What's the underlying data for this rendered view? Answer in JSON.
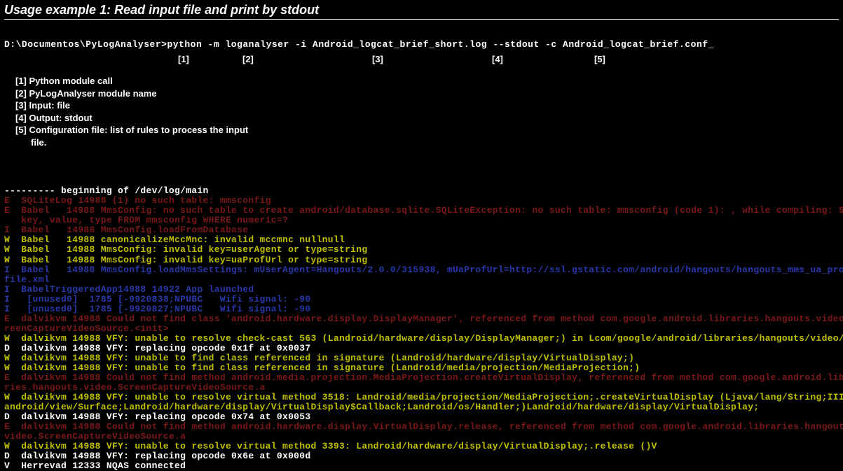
{
  "title": "Usage example 1: Read input file and print by stdout",
  "cmd": {
    "prompt": "D:\\Documentos\\PyLogAnalyser>",
    "part1": "python -m",
    "part2": "loganalyser",
    "part3": "-i Android_logcat_brief_short.log",
    "part4": "--stdout",
    "part5": "-c Android_logcat_brief.conf_"
  },
  "markers": {
    "m1": "[1]",
    "m2": "[2]",
    "m3": "[3]",
    "m4": "[4]",
    "m5": "[5]"
  },
  "legend": {
    "l1": "[1] Python module call",
    "l2": "[2] PyLogAnalyser module name",
    "l3": "[3] Input: file",
    "l4": "[4] Output: stdout",
    "l5": "[5] Configuration file: list of rules to process the input",
    "l5b": "file."
  },
  "log": [
    {
      "cls": "c-white",
      "text": "--------- beginning of /dev/log/main"
    },
    {
      "cls": "c-red",
      "text": "E  SQLiteLog 14988 (1) no such table: mmsconfig"
    },
    {
      "cls": "c-red",
      "text": "E  Babel   14988 MmsConfig: no such table to create android/database.sqlite.SQLiteException: no such table: mmsconfig (code 1): , while compiling: SELECT"
    },
    {
      "cls": "c-red",
      "text": "   key, value, type FROM mmsconfig WHERE numeric=?"
    },
    {
      "cls": "c-red",
      "text": "I  Babel   14988 MmsConfig.loadFromDatabase"
    },
    {
      "cls": "c-yellow",
      "text": "W  Babel   14988 canonicalizeMccMnc: invalid mccmnc nullnull"
    },
    {
      "cls": "c-yellow",
      "text": "W  Babel   14988 MmsConfig: invalid key=userAgent or type=string"
    },
    {
      "cls": "c-yellow",
      "text": "W  Babel   14988 MmsConfig: invalid key=uaProfUrl or type=string"
    },
    {
      "cls": "c-blue",
      "text": "I  Babel   14988 MmsConfig.loadMmsSettings: mUserAgent=Hangouts/2.0.0/315938, mUaProfUrl=http://ssl.gstatic.com/android/hangouts/hangouts_mms_ua_pro"
    },
    {
      "cls": "c-blue",
      "text": "file.xml"
    },
    {
      "cls": "c-blue",
      "text": "I  BabelTriggeredApp14988 14922 App launched"
    },
    {
      "cls": "c-blue",
      "text": "I   [unused0]  1785 [-9920838;NPUBC   Wifi signal: -90"
    },
    {
      "cls": "c-blue",
      "text": "I   [unused0]  1785 [-9920827;NPUBC   Wifi signal: -90"
    },
    {
      "cls": "c-red",
      "text": "E  dalvikvm 14988 Could not find class 'android.hardware.display.DisplayManager', referenced from method com.google.android.libraries.hangouts.video.Sc"
    },
    {
      "cls": "c-red",
      "text": "reenCaptureVideoSource.<init>"
    },
    {
      "cls": "c-yellow",
      "text": "W  dalvikvm 14988 VFY: unable to resolve check-cast 563 (Landroid/hardware/display/DisplayManager;) in Lcom/google/android/libraries/hangouts/video/Sc"
    },
    {
      "cls": "c-white",
      "text": "D  dalvikvm 14988 VFY: replacing opcode 0x1f at 0x0037"
    },
    {
      "cls": "c-yellow",
      "text": "W  dalvikvm 14988 VFY: unable to find class referenced in signature (Landroid/hardware/display/VirtualDisplay;)"
    },
    {
      "cls": "c-yellow",
      "text": "W  dalvikvm 14988 VFY: unable to find class referenced in signature (Landroid/media/projection/MediaProjection;)"
    },
    {
      "cls": "c-red",
      "text": "E  dalvikvm 14988 Could not find method android.media.projection.MediaProjection.createVirtualDisplay, referenced from method com.google.android.libra"
    },
    {
      "cls": "c-red",
      "text": "ries.hangouts.video.ScreenCaptureVideoSource.a"
    },
    {
      "cls": "c-yellow",
      "text": "W  dalvikvm 14988 VFY: unable to resolve virtual method 3518: Landroid/media/projection/MediaProjection;.createVirtualDisplay (Ljava/lang/String;IIIIL"
    },
    {
      "cls": "c-yellow",
      "text": "android/view/Surface;Landroid/hardware/display/VirtualDisplay$Callback;Landroid/os/Handler;)Landroid/hardware/display/VirtualDisplay;"
    },
    {
      "cls": "c-white",
      "text": "D  dalvikvm 14988 VFY: replacing opcode 0x74 at 0x0053"
    },
    {
      "cls": "c-red",
      "text": "E  dalvikvm 14988 Could not find method android.hardware.display.VirtualDisplay.release, referenced from method com.google.android.libraries.hangouts"
    },
    {
      "cls": "c-red",
      "text": "video.ScreenCaptureVideoSource.a"
    },
    {
      "cls": "c-yellow",
      "text": "W  dalvikvm 14988 VFY: unable to resolve virtual method 3393: Landroid/hardware/display/VirtualDisplay;.release ()V"
    },
    {
      "cls": "c-white",
      "text": "D  dalvikvm 14988 VFY: replacing opcode 0x6e at 0x000d"
    },
    {
      "cls": "c-white",
      "text": "V  Herrevad 12333 NQAS connected"
    }
  ]
}
